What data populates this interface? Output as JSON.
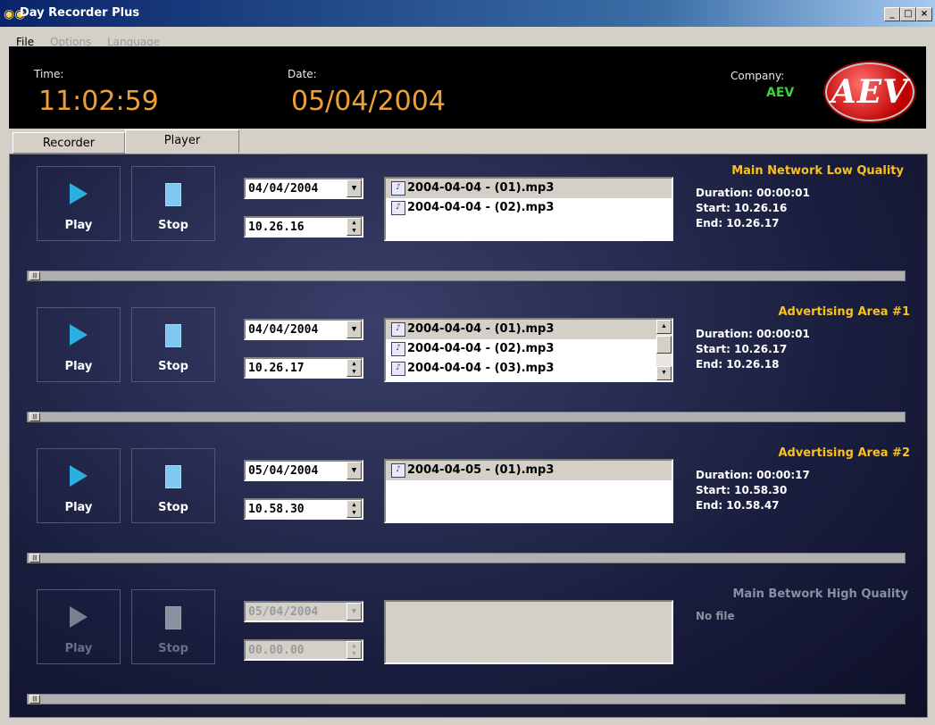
{
  "window": {
    "title": "Day Recorder Plus"
  },
  "menu": [
    "File",
    "Options",
    "Language"
  ],
  "header": {
    "time_label": "Time:",
    "time_value": "11:02:59",
    "date_label": "Date:",
    "date_value": "05/04/2004",
    "company_label": "Company:",
    "company_value": "AEV",
    "logo_text": "AEV"
  },
  "tabs": [
    "Recorder",
    "Player"
  ],
  "colors": {
    "accent": "#f8c020",
    "time": "#f0a030",
    "company": "#40d040",
    "play": "#2ab0e0"
  },
  "sections": [
    {
      "title": "Main Network Low Quality",
      "play_label": "Play",
      "stop_label": "Stop",
      "date": "04/04/2004",
      "time": "10.26.16",
      "files": [
        "2004-04-04 - (01).mp3",
        "2004-04-04 - (02).mp3"
      ],
      "info": [
        "Duration: 00:00:01",
        "Start: 10.26.16",
        "End: 10.26.17"
      ],
      "enabled": true
    },
    {
      "title": "Advertising Area #1",
      "play_label": "Play",
      "stop_label": "Stop",
      "date": "04/04/2004",
      "time": "10.26.17",
      "files": [
        "2004-04-04 - (01).mp3",
        "2004-04-04 - (02).mp3",
        "2004-04-04 - (03).mp3"
      ],
      "info": [
        "Duration: 00:00:01",
        "Start: 10.26.17",
        "End: 10.26.18"
      ],
      "enabled": true
    },
    {
      "title": "Advertising Area #2",
      "play_label": "Play",
      "stop_label": "Stop",
      "date": "05/04/2004",
      "time": "10.58.30",
      "files": [
        "2004-04-05 - (01).mp3"
      ],
      "info": [
        "Duration: 00:00:17",
        "Start: 10.58.30",
        "End: 10.58.47"
      ],
      "enabled": true
    },
    {
      "title": "Main Betwork High Quality",
      "play_label": "Play",
      "stop_label": "Stop",
      "date": "05/04/2004",
      "time": "00.00.00",
      "files": [],
      "info": [
        "No file"
      ],
      "enabled": false
    }
  ]
}
